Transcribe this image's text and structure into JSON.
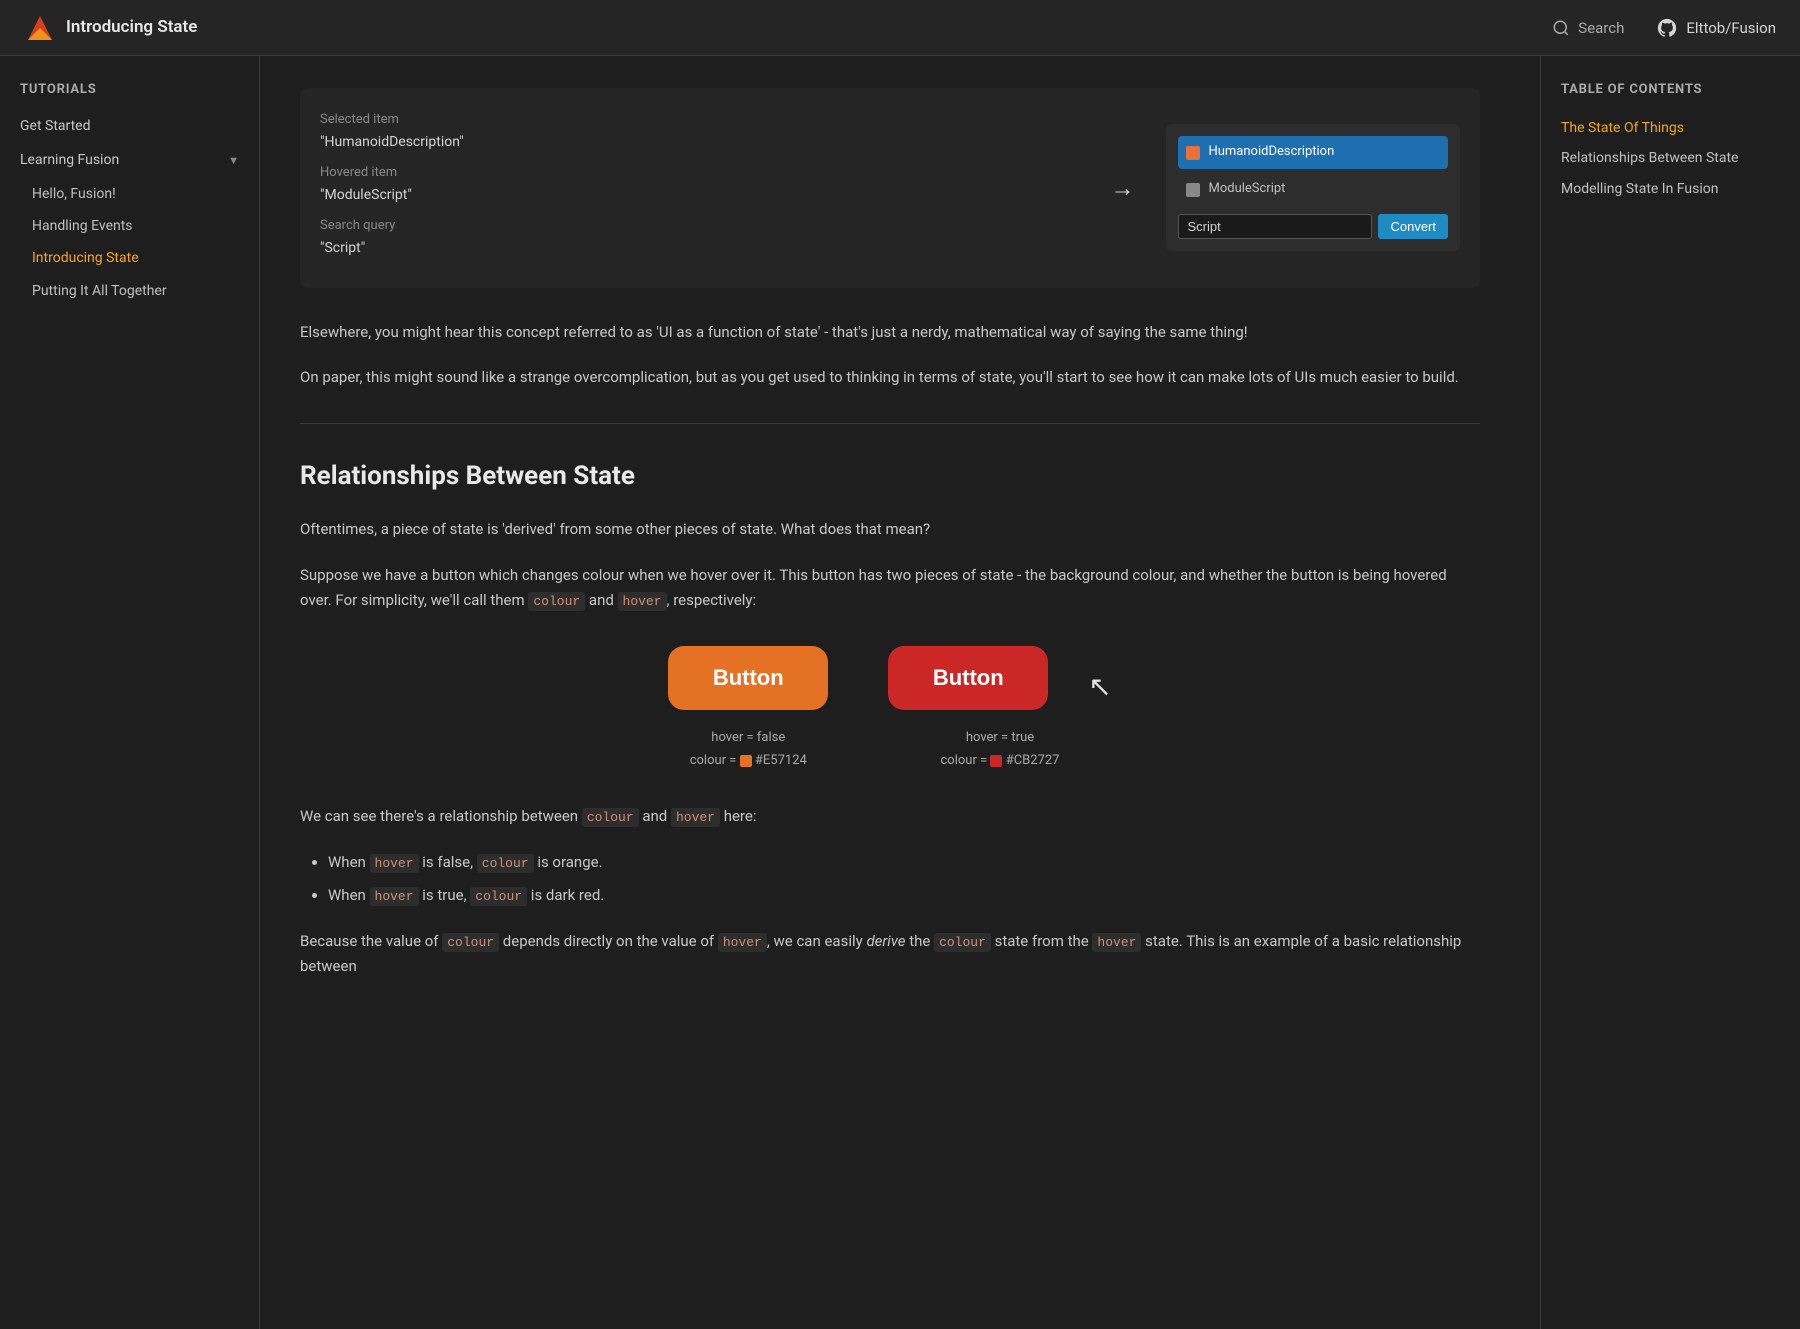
{
  "header": {
    "title": "Introducing State",
    "search_label": "Search",
    "github_label": "Elttob/Fusion"
  },
  "sidebar": {
    "tutorials_label": "Tutorials",
    "get_started": "Get Started",
    "learning_fusion": "Learning Fusion",
    "sub_items": [
      {
        "label": "Hello, Fusion!",
        "active": false
      },
      {
        "label": "Handling Events",
        "active": false
      },
      {
        "label": "Introducing State",
        "active": true
      },
      {
        "label": "Putting It All Together",
        "active": false
      }
    ]
  },
  "toc": {
    "title": "Table of contents",
    "items": [
      {
        "label": "The State Of Things",
        "active": true
      },
      {
        "label": "Relationships Between State",
        "active": false
      },
      {
        "label": "Modelling State In Fusion",
        "active": false
      }
    ]
  },
  "demo_top": {
    "selected_item_label": "Selected item",
    "selected_item_value": "\"HumanoidDescription\"",
    "hovered_item_label": "Hovered item",
    "hovered_item_value": "\"ModuleScript\"",
    "search_query_label": "Search query",
    "search_query_value": "\"Script\"",
    "list_item_1": "HumanoidDescription",
    "list_item_2": "ModuleScript",
    "search_input_placeholder": "Script",
    "convert_btn_label": "Convert"
  },
  "content": {
    "para_1": "Elsewhere, you might hear this concept referred to as 'UI as a function of state' - that's just a nerdy, mathematical way of saying the same thing!",
    "para_2": "On paper, this might sound like a strange overcomplication, but as you get used to thinking in terms of state, you'll start to see how it can make lots of UIs much easier to build.",
    "relationships_heading": "Relationships Between State",
    "relationships_para_1": "Oftentimes, a piece of state is 'derived' from some other pieces of state. What does that mean?",
    "relationships_para_2_before": "Suppose we have a button which changes colour when we hover over it. This button has two pieces of state - the background colour, and whether the button is being hovered over. For simplicity, we'll call them ",
    "relationships_para_2_code1": "colour",
    "relationships_para_2_mid": " and ",
    "relationships_para_2_code2": "hover",
    "relationships_para_2_after": ", respectively:",
    "btn1_label": "Button",
    "btn2_label": "Button",
    "btn1_hover": "hover = false",
    "btn1_colour": "colour = ",
    "btn1_colour_hex": "#E57124",
    "btn2_hover": "hover = true",
    "btn2_colour": "colour = ",
    "btn2_colour_hex": "#CB2727",
    "btn1_swatch_color": "#E57124",
    "btn2_swatch_color": "#CB2727",
    "we_can_see_before": "We can see there's a relationship between ",
    "we_can_see_code1": "colour",
    "we_can_see_mid1": " and ",
    "we_can_see_code2": "hover",
    "we_can_see_after": " here:",
    "bullet_1_before": "When ",
    "bullet_1_code": "hover",
    "bullet_1_mid": " is false, ",
    "bullet_1_code2": "colour",
    "bullet_1_after": " is orange.",
    "bullet_2_before": "When ",
    "bullet_2_code": "hover",
    "bullet_2_mid": " is true, ",
    "bullet_2_code2": "colour",
    "bullet_2_after": " is dark red.",
    "because_before": "Because the value of ",
    "because_code1": "colour",
    "because_mid": " depends directly on the value of ",
    "because_code2": "hover",
    "because_after": ", we can easily ",
    "because_em": "derive",
    "because_after2": " the ",
    "because_code3": "colour",
    "because_after3": " state from the ",
    "because_code4": "hover",
    "because_after4": " state. This is an example of a basic relationship between"
  }
}
